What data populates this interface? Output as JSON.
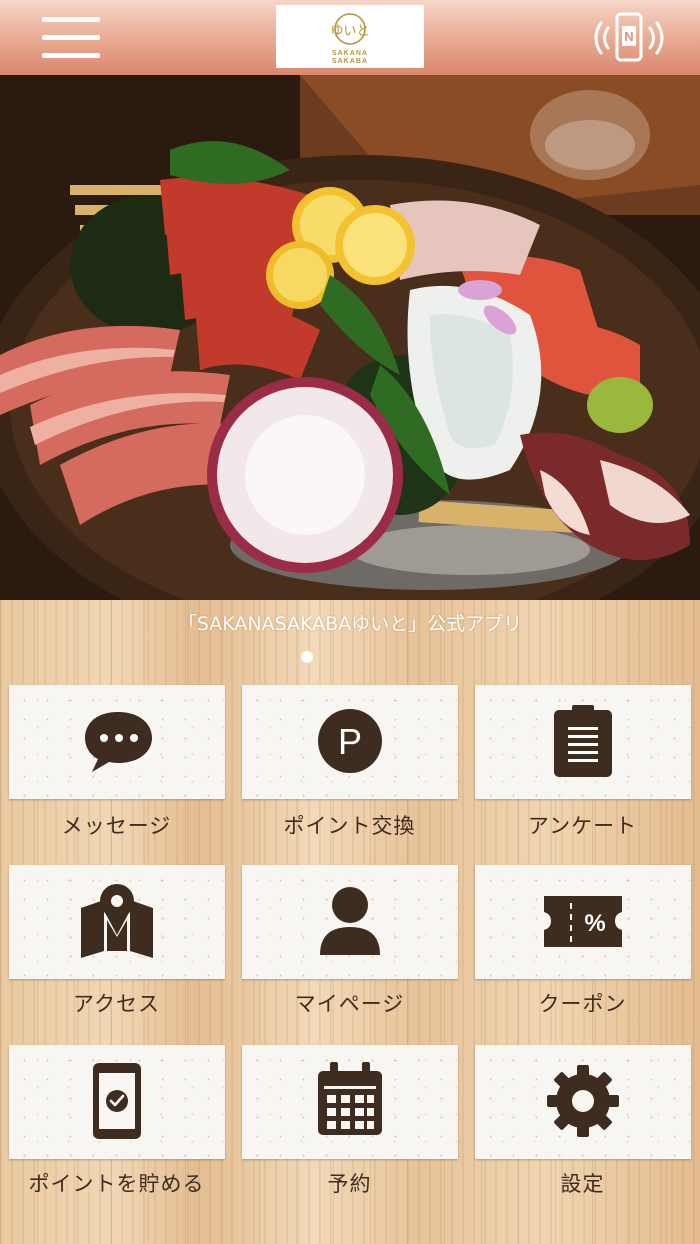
{
  "header": {
    "logo_text": "SAKANA SAKABA",
    "logo_line1": "SAKANA",
    "logo_line2": "SAKABA",
    "logo_glyphs": "ゆいと",
    "menu_icon": "hamburger-icon",
    "nfc_icon": "nfc-phone-icon",
    "bg_color": "#e8a890"
  },
  "hero": {
    "image_description_icon": "sashimi-platter-photo"
  },
  "tagline": "「SAKANASAKABAゆいと」公式アプリ",
  "pager": {
    "active_index": 0,
    "count": 1
  },
  "menu": [
    {
      "label": "メッセージ",
      "icon": "message-bubble-icon"
    },
    {
      "label": "ポイント交換",
      "icon": "point-coin-icon"
    },
    {
      "label": "アンケート",
      "icon": "clipboard-icon"
    },
    {
      "label": "アクセス",
      "icon": "map-pin-icon"
    },
    {
      "label": "マイページ",
      "icon": "user-icon"
    },
    {
      "label": "クーポン",
      "icon": "coupon-icon"
    },
    {
      "label": "ポイントを貯める",
      "icon": "phone-check-icon"
    },
    {
      "label": "予約",
      "icon": "calendar-icon"
    },
    {
      "label": "設定",
      "icon": "gear-icon"
    }
  ],
  "colors": {
    "icon": "#3f2c20",
    "label": "#3f2c20",
    "tagline": "#ffffff",
    "logo_gold": "#b8953b"
  },
  "coupon_symbol": "%",
  "point_symbol": "P"
}
